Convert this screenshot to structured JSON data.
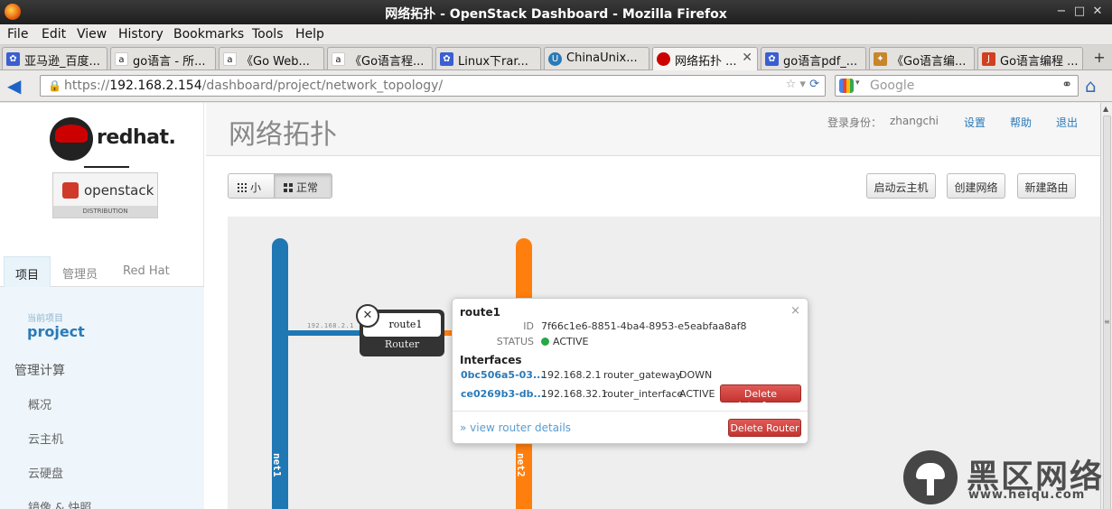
{
  "window": {
    "title": "网络拓扑 - OpenStack Dashboard - Mozilla Firefox",
    "controls": [
      "−",
      "□",
      "✕"
    ]
  },
  "menubar": [
    "File",
    "Edit",
    "View",
    "History",
    "Bookmarks",
    "Tools",
    "Help"
  ],
  "tabs": [
    {
      "label": "亚马逊_百度...",
      "icon": "paw-icon",
      "color": "#3a5fd0"
    },
    {
      "label": "go语言 - 所...",
      "icon": "amazon-icon",
      "color": "#f5a623"
    },
    {
      "label": "《Go Web...",
      "icon": "amazon-icon",
      "color": "#f5a623"
    },
    {
      "label": "《Go语言程...",
      "icon": "amazon-icon",
      "color": "#f5a623"
    },
    {
      "label": "Linux下rar...",
      "icon": "paw-icon",
      "color": "#3a5fd0"
    },
    {
      "label": "ChinaUnix...",
      "icon": "chinaunix-icon",
      "color": "#2a7ab8"
    },
    {
      "label": "网络拓扑 ...",
      "icon": "redhat-icon",
      "color": "#cc0000",
      "active": true
    },
    {
      "label": "go语言pdf_...",
      "icon": "paw-icon",
      "color": "#3a5fd0"
    },
    {
      "label": "《Go语言编...",
      "icon": "book-icon",
      "color": "#c8862a"
    },
    {
      "label": "Go语言编程 ...",
      "icon": "jb-icon",
      "color": "#d04020"
    }
  ],
  "nav": {
    "url_scheme": "https://",
    "url_host": "192.168.2.154",
    "url_path": "/dashboard/project/network_topology/",
    "search_placeholder": "Google"
  },
  "sidebar": {
    "brand": "redhat.",
    "openstack": "openstack",
    "distribution": "DISTRIBUTION",
    "tabs": [
      "项目",
      "管理员",
      "Red Hat"
    ],
    "current_project_label": "当前项目",
    "current_project": "project",
    "section": "管理计算",
    "items": [
      "概况",
      "云主机",
      "云硬盘",
      "镜像 & 快照"
    ]
  },
  "header": {
    "title": "网络拓扑",
    "user_label": "登录身份：",
    "user": "zhangchi",
    "settings": "设置",
    "help": "帮助",
    "logout": "退出"
  },
  "toolbar": {
    "small": "小",
    "normal": "正常",
    "launch_instance": "启动云主机",
    "create_network": "创建网络",
    "create_router": "新建路由"
  },
  "topology": {
    "networks": [
      {
        "name": "net1",
        "color": "#1f77b4"
      },
      {
        "name": "net2",
        "color": "#ff7f0e"
      }
    ],
    "link_ip": "192.168.2.1",
    "router": {
      "name": "route1",
      "type": "Router"
    }
  },
  "popup": {
    "title": "route1",
    "id_label": "ID",
    "id": "7f66c1e6-8851-4ba4-8953-e5eabfaa8af8",
    "status_label": "STATUS",
    "status": "ACTIVE",
    "interfaces_label": "Interfaces",
    "interfaces": [
      {
        "port": "0bc506a5-03...",
        "ip": "192.168.2.1",
        "type": "router_gateway",
        "status": "DOWN"
      },
      {
        "port": "ce0269b3-db...",
        "ip": "192.168.32.1",
        "type": "router_interface",
        "status": "ACTIVE",
        "action": "Delete Interface"
      }
    ],
    "details_link": "» view router details",
    "delete_router": "Delete Router"
  },
  "watermark": {
    "title": "黑区网络",
    "url": "www.heiqu.com"
  }
}
